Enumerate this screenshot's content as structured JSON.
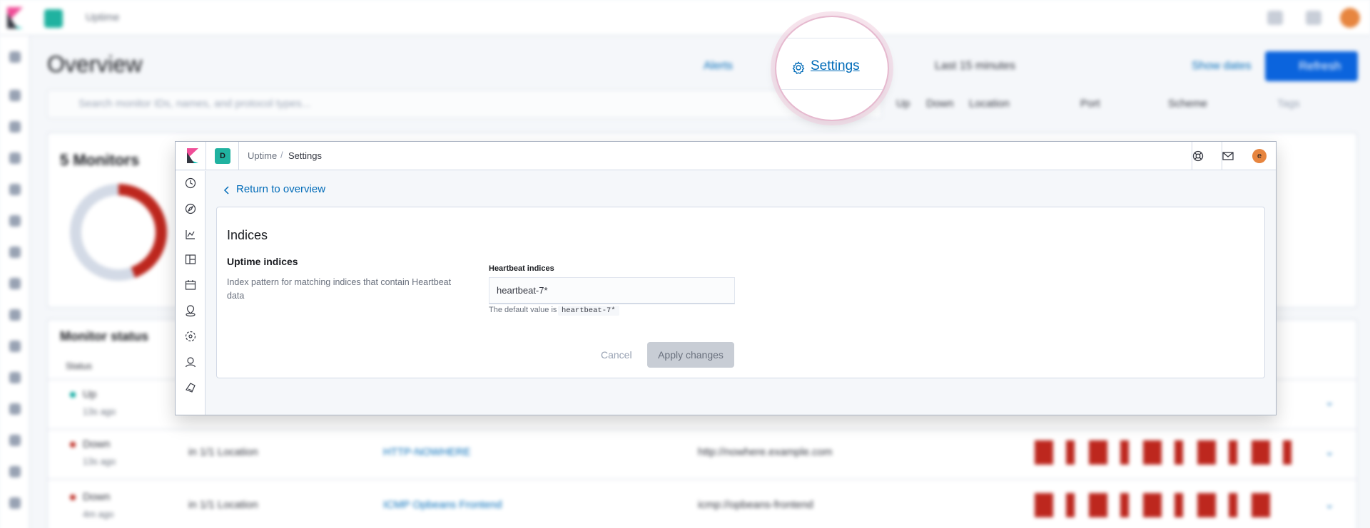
{
  "background": {
    "app_title": "Uptime",
    "page_title": "Overview",
    "header_links": [
      "Alerts",
      "Last 15 minutes",
      "Show dates"
    ],
    "refresh_label": "Refresh",
    "search_placeholder": "Search monitor IDs, names, and protocol types...",
    "filters": [
      "Up",
      "Down",
      "Location",
      "Port",
      "Scheme",
      "Tags"
    ],
    "summary_title": "5 Monitors",
    "status_title": "Monitor status",
    "status_column": "Status",
    "rows": [
      {
        "status": "Up",
        "ago": "13s ago",
        "color": "#00a69b",
        "location": "",
        "name": "",
        "url": ""
      },
      {
        "status": "Down",
        "ago": "13s ago",
        "color": "#bd271e",
        "location": "in 1/1 Location",
        "name": "HTTP-NOWHERE",
        "url": "http://nowhere.example.com"
      },
      {
        "status": "Down",
        "ago": "4m ago",
        "color": "#bd271e",
        "location": "in 1/1 Location",
        "name": "ICMP Opbeans Frontend",
        "url": "icmp://opbeans-frontend"
      }
    ]
  },
  "magnifier": {
    "settings_label": "Settings",
    "icon": "gear-icon"
  },
  "window": {
    "space_initial": "D",
    "breadcrumb": [
      "Uptime",
      "Settings"
    ],
    "avatar_initial": "e",
    "header_icons": [
      "help-icon",
      "mail-icon"
    ],
    "nav_icons": [
      "clock-icon",
      "compass-icon",
      "chart-icon",
      "dashboard-icon",
      "calendar-icon",
      "map-icon",
      "ml-icon",
      "user-icon",
      "logs-icon"
    ],
    "return_link": "Return to overview",
    "card_title": "Indices",
    "section_title": "Uptime indices",
    "section_description": "Index pattern for matching indices that contain Heartbeat data",
    "field_label": "Heartbeat indices",
    "field_value": "heartbeat-7*",
    "help_text": "The default value is",
    "help_code": "heartbeat-7*",
    "cancel_label": "Cancel",
    "apply_label": "Apply changes"
  },
  "colors": {
    "accent": "#006bb8",
    "primary_button": "#0b64dd",
    "danger": "#bd271e",
    "space_badge": "#20b2a0",
    "avatar": "#e7853f"
  }
}
